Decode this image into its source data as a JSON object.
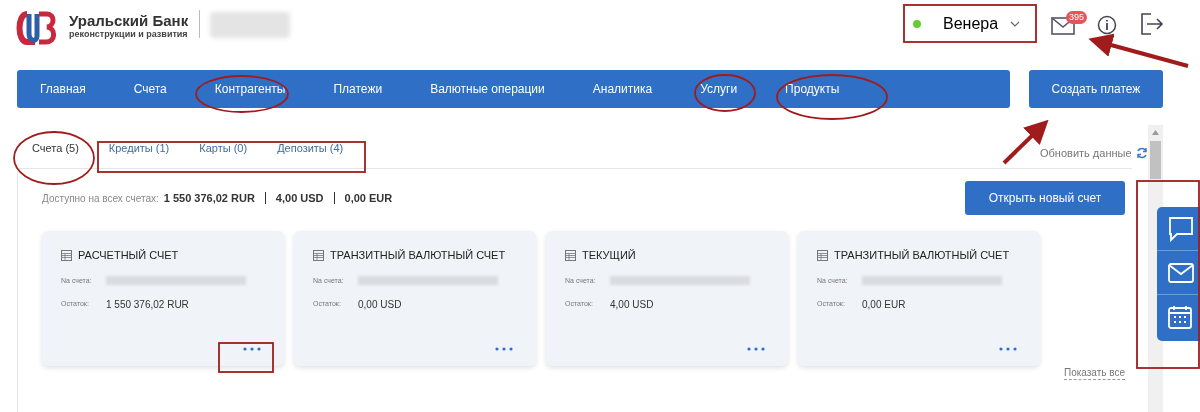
{
  "header": {
    "bank_name": "Уральский Банк",
    "bank_subtitle": "реконструкции и развития",
    "user": {
      "name": "Венера",
      "online": true
    },
    "mail_badge": "395"
  },
  "nav": {
    "items": [
      {
        "label": "Главная"
      },
      {
        "label": "Счета"
      },
      {
        "label": "Контрагенты"
      },
      {
        "label": "Платежи"
      },
      {
        "label": "Валютные операции"
      },
      {
        "label": "Аналитика"
      },
      {
        "label": "Услуги"
      },
      {
        "label": "Продукты"
      }
    ],
    "create_button": "Создать платеж"
  },
  "tabs": [
    {
      "label": "Счета (5)",
      "selected": true
    },
    {
      "label": "Кредиты (1)",
      "selected": false
    },
    {
      "label": "Карты (0)",
      "selected": false
    },
    {
      "label": "Депозиты (4)",
      "selected": false
    }
  ],
  "refresh_link": "Обновить данные",
  "summary": {
    "label": "Доступно на всех счетах:",
    "amounts": [
      "1 550 376,02 RUR",
      "4,00 USD",
      "0,00 EUR"
    ]
  },
  "open_account_button": "Открыть новый счет",
  "accounts": [
    {
      "title": "РАСЧЕТНЫЙ СЧЕТ",
      "number_label": "Na счета:",
      "balance_label": "Остаток:",
      "balance": "1 550 376,02 RUR"
    },
    {
      "title": "ТРАНЗИТНЫЙ ВАЛЮТНЫЙ СЧЕТ",
      "number_label": "Na счета:",
      "balance_label": "Остаток:",
      "balance": "0,00 USD"
    },
    {
      "title": "ТЕКУЩИЙ",
      "number_label": "Na счета:",
      "balance_label": "Остаток:",
      "balance": "4,00 USD"
    },
    {
      "title": "ТРАНЗИТНЫЙ ВАЛЮТНЫЙ СЧЕТ",
      "number_label": "Na счета:",
      "balance_label": "Остаток:",
      "balance": "0,00 EUR"
    }
  ],
  "show_all_link": "Показать все"
}
